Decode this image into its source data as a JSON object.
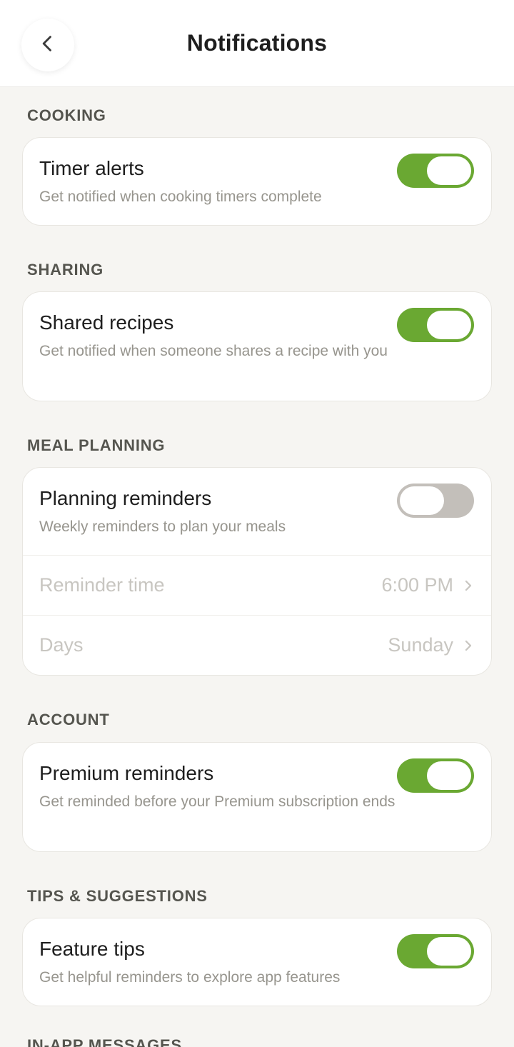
{
  "header": {
    "title": "Notifications",
    "back_icon": "chevron-left-icon"
  },
  "sections": {
    "cooking": {
      "title": "COOKING",
      "item": {
        "title": "Timer alerts",
        "desc": "Get notified when cooking timers complete",
        "enabled": true
      }
    },
    "sharing": {
      "title": "SHARING",
      "item": {
        "title": "Shared recipes",
        "desc": "Get notified when someone shares a recipe with you",
        "enabled": true
      }
    },
    "meal_planning": {
      "title": "MEAL PLANNING",
      "item": {
        "title": "Planning reminders",
        "desc": "Weekly reminders to plan your meals",
        "enabled": false
      },
      "reminder_time": {
        "label": "Reminder time",
        "value": "6:00 PM"
      },
      "days": {
        "label": "Days",
        "value": "Sunday"
      }
    },
    "account": {
      "title": "ACCOUNT",
      "item": {
        "title": "Premium reminders",
        "desc": "Get reminded before your Premium subscription ends",
        "enabled": true
      }
    },
    "tips": {
      "title": "TIPS & SUGGESTIONS",
      "item": {
        "title": "Feature tips",
        "desc": "Get helpful reminders to explore app features",
        "enabled": true
      }
    },
    "in_app": {
      "title": "IN-APP MESSAGES"
    }
  },
  "colors": {
    "accent_green": "#6aa832",
    "toggle_off": "#c3bfba",
    "background": "#f6f5f2"
  }
}
